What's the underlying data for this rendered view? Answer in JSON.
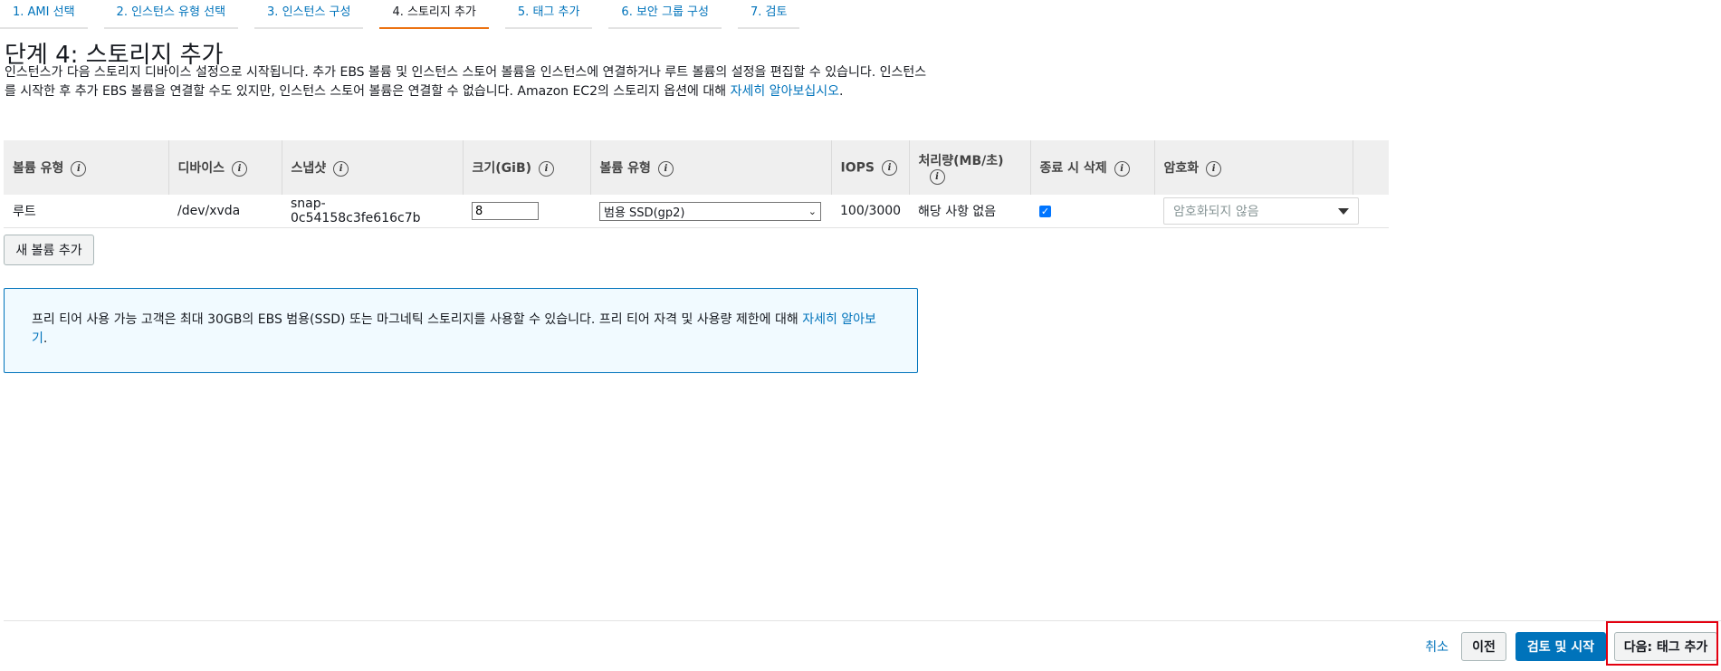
{
  "tabs": [
    {
      "label": "1. AMI 선택"
    },
    {
      "label": "2. 인스턴스 유형 선택"
    },
    {
      "label": "3. 인스턴스 구성"
    },
    {
      "label": "4. 스토리지 추가"
    },
    {
      "label": "5. 태그 추가"
    },
    {
      "label": "6. 보안 그룹 구성"
    },
    {
      "label": "7. 검토"
    }
  ],
  "page": {
    "title": "단계 4: 스토리지 추가",
    "description": "인스턴스가 다음 스토리지 디바이스 설정으로 시작됩니다. 추가 EBS 볼륨 및 인스턴스 스토어 볼륨을 인스턴스에 연결하거나 루트 볼륨의 설정을 편집할 수 있습니다. 인스턴스를 시작한 후 추가 EBS 볼륨을 연결할 수도 있지만, 인스턴스 스토어 볼륨은 연결할 수 없습니다. Amazon EC2의 스토리지 옵션에 대해 ",
    "learn_more": "자세히 알아보십시오",
    "desc_end": "."
  },
  "table": {
    "headers": {
      "volume_type": "볼륨 유형",
      "device": "디바이스",
      "snapshot": "스냅샷",
      "size": "크기(GiB)",
      "vol_type": "볼륨 유형",
      "iops": "IOPS",
      "throughput": "처리량(MB/초)",
      "delete_on_term": "종료 시 삭제",
      "encryption": "암호화"
    },
    "row": {
      "volume_type": "루트",
      "device": "/dev/xvda",
      "snapshot": "snap-0c54158c3fe616c7b",
      "size": "8",
      "vol_type": "범용 SSD(gp2)",
      "iops": "100/3000",
      "throughput": "해당 사항 없음",
      "encryption": "암호화되지 않음"
    }
  },
  "add_volume_label": "새 볼륨 추가",
  "alert": {
    "text": "프리 티어 사용 가능 고객은 최대 30GB의 EBS 범용(SSD) 또는 마그네틱 스토리지를 사용할 수 있습니다. 프리 티어 자격 및 사용량 제한에 대해 ",
    "link": "자세히 알아보기",
    "end": "."
  },
  "footer": {
    "cancel": "취소",
    "prev": "이전",
    "review": "검토 및 시작",
    "next": "다음: 태그 추가"
  },
  "colors": {
    "primary": "#0073bb",
    "active_tab": "#ec7211",
    "highlight": "#e3000f"
  },
  "icons": {
    "info": "i"
  }
}
